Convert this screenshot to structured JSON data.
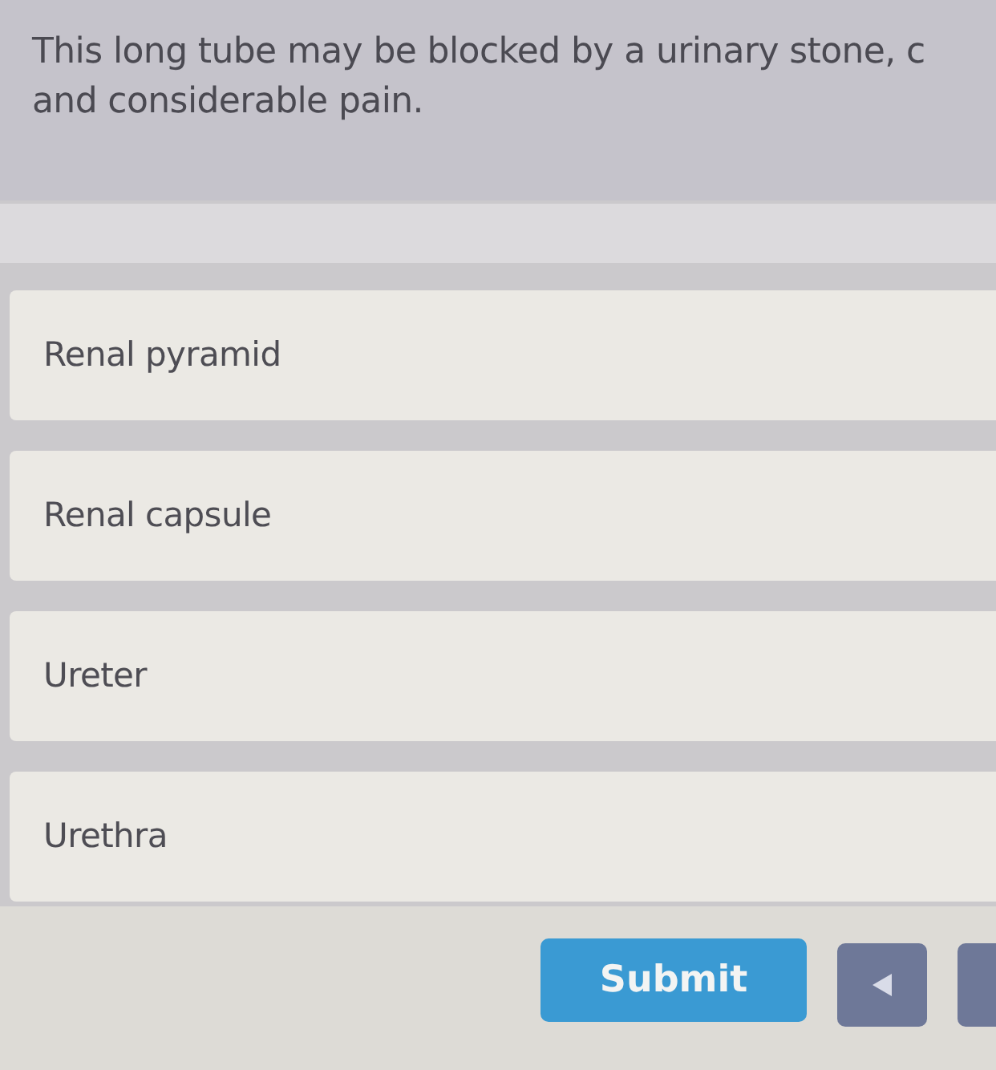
{
  "question": {
    "text": "This long tube may be blocked by a urinary stone, c and considerable pain."
  },
  "options": [
    {
      "label": "Renal pyramid",
      "selected": false
    },
    {
      "label": "Renal capsule",
      "selected": false
    },
    {
      "label": "Ureter",
      "selected": false
    },
    {
      "label": "Urethra",
      "selected": false
    }
  ],
  "submit_button": {
    "label": "Submit"
  }
}
